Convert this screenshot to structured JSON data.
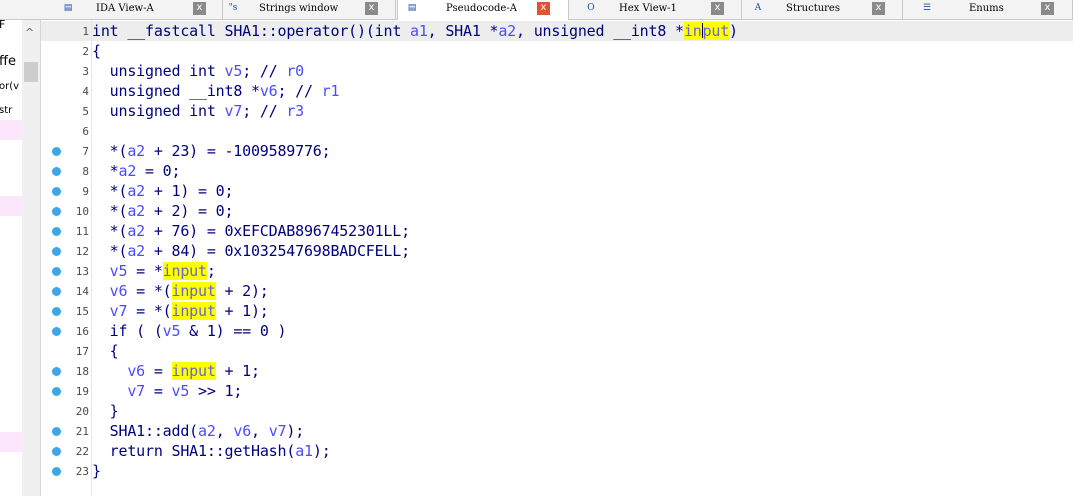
{
  "tabs": [
    {
      "icon": "disassembly-icon",
      "icon_glyph": "▤",
      "label": "IDA View-A",
      "active": false
    },
    {
      "icon": "strings-icon",
      "icon_glyph": "\"s",
      "label": "Strings window",
      "active": false
    },
    {
      "icon": "pseudocode-icon",
      "icon_glyph": "▤",
      "label": "Pseudocode-A",
      "active": true
    },
    {
      "icon": "hex-icon",
      "icon_glyph": "O",
      "label": "Hex View-1",
      "active": false
    },
    {
      "icon": "structures-icon",
      "icon_glyph": "A",
      "label": "Structures",
      "active": false
    },
    {
      "icon": "enums-icon",
      "icon_glyph": "☰",
      "label": "Enums",
      "active": false
    }
  ],
  "close_glyph": "x",
  "left_panel": {
    "fragments": [
      "F",
      "ffe",
      "or(v",
      "str"
    ]
  },
  "code_lines": [
    {
      "n": "1",
      "bp": false,
      "text": "int __fastcall SHA1::operator()(int a1, SHA1 *a2, unsigned __int8 *input)"
    },
    {
      "n": "2",
      "bp": false,
      "text": "{"
    },
    {
      "n": "3",
      "bp": false,
      "text": "  unsigned int v5; // r0"
    },
    {
      "n": "4",
      "bp": false,
      "text": "  unsigned __int8 *v6; // r1"
    },
    {
      "n": "5",
      "bp": false,
      "text": "  unsigned int v7; // r3"
    },
    {
      "n": "6",
      "bp": false,
      "text": ""
    },
    {
      "n": "7",
      "bp": true,
      "text": "  *(a2 + 23) = -1009589776;"
    },
    {
      "n": "8",
      "bp": true,
      "text": "  *a2 = 0;"
    },
    {
      "n": "9",
      "bp": true,
      "text": "  *(a2 + 1) = 0;"
    },
    {
      "n": "10",
      "bp": true,
      "text": "  *(a2 + 2) = 0;"
    },
    {
      "n": "11",
      "bp": true,
      "text": "  *(a2 + 76) = 0xEFCDAB8967452301LL;"
    },
    {
      "n": "12",
      "bp": true,
      "text": "  *(a2 + 84) = 0x1032547698BADCFELL;"
    },
    {
      "n": "13",
      "bp": true,
      "text": "  v5 = *input;"
    },
    {
      "n": "14",
      "bp": true,
      "text": "  v6 = *(input + 2);"
    },
    {
      "n": "15",
      "bp": true,
      "text": "  v7 = *(input + 1);"
    },
    {
      "n": "16",
      "bp": true,
      "text": "  if ( (v5 & 1) == 0 )"
    },
    {
      "n": "17",
      "bp": false,
      "text": "  {"
    },
    {
      "n": "18",
      "bp": true,
      "text": "    v6 = input + 1;"
    },
    {
      "n": "19",
      "bp": true,
      "text": "    v7 = v5 >> 1;"
    },
    {
      "n": "20",
      "bp": false,
      "text": "  }"
    },
    {
      "n": "21",
      "bp": true,
      "text": "  SHA1::add(a2, v6, v7);"
    },
    {
      "n": "22",
      "bp": true,
      "text": "  return SHA1::getHash(a1);"
    },
    {
      "n": "23",
      "bp": true,
      "text": "}"
    }
  ],
  "highlight_word": "input",
  "colors": {
    "highlight": "#ffff00",
    "breakpoint": "#3da5e8",
    "keyword": "#00007f",
    "variable": "#4b4bff",
    "active_tab_close": "#e0552f"
  }
}
